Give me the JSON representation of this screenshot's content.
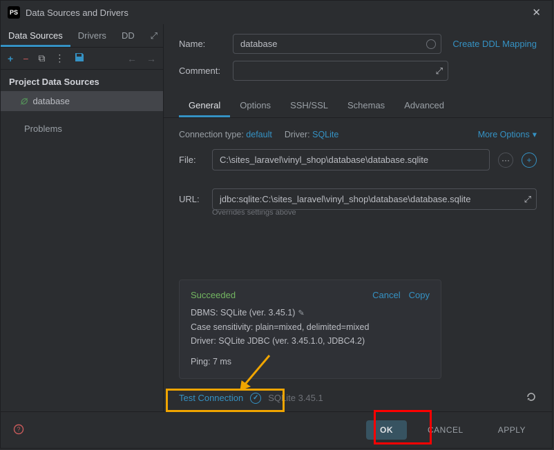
{
  "titlebar": {
    "title": "Data Sources and Drivers"
  },
  "sideTabs": {
    "t0": "Data Sources",
    "t1": "Drivers",
    "t2": "DD"
  },
  "section": {
    "project": "Project Data Sources",
    "problems": "Problems"
  },
  "tree": {
    "item0": "database"
  },
  "form": {
    "name_label": "Name:",
    "name_value": "database",
    "comment_label": "Comment:",
    "create_ddl": "Create DDL Mapping"
  },
  "mainTabs": {
    "t0": "General",
    "t1": "Options",
    "t2": "SSH/SSL",
    "t3": "Schemas",
    "t4": "Advanced"
  },
  "meta": {
    "ctype_k": "Connection type:",
    "ctype_v": "default",
    "driver_k": "Driver:",
    "driver_v": "SQLite",
    "more": "More Options"
  },
  "fields": {
    "file_label": "File:",
    "file_value": "C:\\sites_laravel\\vinyl_shop\\database\\database.sqlite",
    "url_label": "URL:",
    "url_value": "jdbc:sqlite:C:\\sites_laravel\\vinyl_shop\\database\\database.sqlite",
    "hint": "Overrides settings above"
  },
  "result": {
    "status": "Succeeded",
    "cancel": "Cancel",
    "copy": "Copy",
    "line1": "DBMS: SQLite (ver. 3.45.1)",
    "line2": "Case sensitivity: plain=mixed, delimited=mixed",
    "line3": "Driver: SQLite JDBC (ver. 3.45.1.0, JDBC4.2)",
    "ping": "Ping: 7 ms"
  },
  "test": {
    "link": "Test Connection",
    "ver": "SQLite 3.45.1"
  },
  "footer": {
    "ok": "OK",
    "cancel": "CANCEL",
    "apply": "APPLY"
  }
}
